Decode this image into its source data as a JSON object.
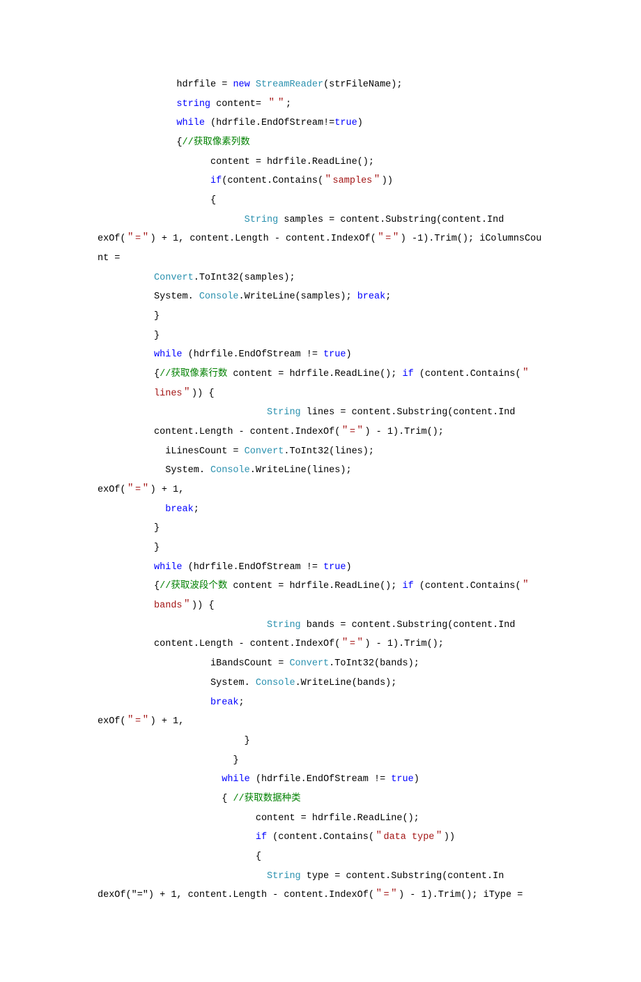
{
  "code": {
    "lines": [
      [
        {
          "indent": 14,
          "text": "hdrfile = ",
          "cls": "tok-plain"
        },
        {
          "text": "new ",
          "cls": "tok-kw"
        },
        {
          "text": "StreamReader",
          "cls": "tok-cls"
        },
        {
          "text": "(strFileName);",
          "cls": "tok-plain"
        }
      ],
      [
        {
          "indent": 14,
          "text": "string",
          "cls": "tok-kw"
        },
        {
          "text": " content= ",
          "cls": "tok-plain"
        },
        {
          "text": "＂＂",
          "cls": "tok-str"
        },
        {
          "text": ";",
          "cls": "tok-plain"
        }
      ],
      [
        {
          "indent": 14,
          "text": "while",
          "cls": "tok-kw"
        },
        {
          "text": " (hdrfile.EndOfStream!=",
          "cls": "tok-plain"
        },
        {
          "text": "true",
          "cls": "tok-kw"
        },
        {
          "text": ")",
          "cls": "tok-plain"
        }
      ],
      [
        {
          "indent": 14,
          "text": "{",
          "cls": "tok-plain"
        },
        {
          "text": "//获取像素列数",
          "cls": "tok-cmt"
        }
      ],
      [
        {
          "indent": 20,
          "text": "content = hdrfile.ReadLine();",
          "cls": "tok-plain"
        }
      ],
      [
        {
          "indent": 20,
          "text": "if",
          "cls": "tok-kw"
        },
        {
          "text": "(content.Contains(",
          "cls": "tok-plain"
        },
        {
          "text": "＂samples＂",
          "cls": "tok-str"
        },
        {
          "text": "))",
          "cls": "tok-plain"
        }
      ],
      [
        {
          "indent": 20,
          "text": "{",
          "cls": "tok-plain"
        }
      ],
      [
        {
          "indent": 26,
          "text": "String",
          "cls": "tok-cls"
        },
        {
          "text": " samples = content.Substring(content.Ind",
          "cls": "tok-plain"
        }
      ],
      [
        {
          "indent": 0,
          "text": "exOf(",
          "cls": "tok-plain"
        },
        {
          "text": "＂=＂",
          "cls": "tok-str"
        },
        {
          "text": ") + 1, content.Length - content.IndexOf(",
          "cls": "tok-plain"
        },
        {
          "text": "＂=＂",
          "cls": "tok-str"
        },
        {
          "text": ") -1).Trim(); iColumnsCount = ",
          "cls": "tok-plain"
        }
      ],
      [
        {
          "indent": 10,
          "text": "Convert",
          "cls": "tok-cls"
        },
        {
          "text": ".ToInt32(samples);",
          "cls": "tok-plain"
        }
      ],
      [
        {
          "indent": 10,
          "text": "System. ",
          "cls": "tok-plain"
        },
        {
          "text": "Console",
          "cls": "tok-cls"
        },
        {
          "text": ".WriteLine(samples); ",
          "cls": "tok-plain"
        },
        {
          "text": "break",
          "cls": "tok-kw"
        },
        {
          "text": ";",
          "cls": "tok-plain"
        }
      ],
      [
        {
          "indent": 10,
          "text": "}",
          "cls": "tok-plain"
        }
      ],
      [
        {
          "indent": 10,
          "text": "}",
          "cls": "tok-plain"
        }
      ],
      [
        {
          "indent": 10,
          "text": "while",
          "cls": "tok-kw"
        },
        {
          "text": " (hdrfile.EndOfStream != ",
          "cls": "tok-plain"
        },
        {
          "text": "true",
          "cls": "tok-kw"
        },
        {
          "text": ")",
          "cls": "tok-plain"
        }
      ],
      [
        {
          "indent": 10,
          "text": "{",
          "cls": "tok-plain"
        },
        {
          "text": "//获取像素行数",
          "cls": "tok-cmt"
        },
        {
          "text": " content = hdrfile.ReadLine(); ",
          "cls": "tok-plain"
        },
        {
          "text": "if",
          "cls": "tok-kw"
        },
        {
          "text": " (content.Contains(",
          "cls": "tok-plain"
        },
        {
          "text": "＂",
          "cls": "tok-str"
        }
      ],
      [
        {
          "indent": 10,
          "text": "lines＂",
          "cls": "tok-str"
        },
        {
          "text": ")) {",
          "cls": "tok-plain"
        }
      ],
      [
        {
          "indent": 30,
          "text": "String",
          "cls": "tok-cls"
        },
        {
          "text": " lines = content.Substring(content.Ind",
          "cls": "tok-plain"
        }
      ],
      [
        {
          "indent": 10,
          "text": "content.Length - content.IndexOf(",
          "cls": "tok-plain"
        },
        {
          "text": "＂=＂",
          "cls": "tok-str"
        },
        {
          "text": ") - 1).Trim();",
          "cls": "tok-plain"
        }
      ],
      [
        {
          "indent": 12,
          "text": "iLinesCount = ",
          "cls": "tok-plain"
        },
        {
          "text": "Convert",
          "cls": "tok-cls"
        },
        {
          "text": ".ToInt32(lines);",
          "cls": "tok-plain"
        }
      ],
      [
        {
          "indent": 12,
          "text": "System. ",
          "cls": "tok-plain"
        },
        {
          "text": "Console",
          "cls": "tok-cls"
        },
        {
          "text": ".WriteLine(lines);",
          "cls": "tok-plain"
        }
      ],
      [
        {
          "indent": 0,
          "text": "exOf(",
          "cls": "tok-plain"
        },
        {
          "text": "＂=＂",
          "cls": "tok-str"
        },
        {
          "text": ") + 1,",
          "cls": "tok-plain"
        }
      ],
      [
        {
          "indent": 12,
          "text": "break",
          "cls": "tok-kw"
        },
        {
          "text": ";",
          "cls": "tok-plain"
        }
      ],
      [
        {
          "indent": 10,
          "text": "}",
          "cls": "tok-plain"
        }
      ],
      [
        {
          "indent": 10,
          "text": "}",
          "cls": "tok-plain"
        }
      ],
      [
        {
          "indent": 10,
          "text": "while",
          "cls": "tok-kw"
        },
        {
          "text": " (hdrfile.EndOfStream != ",
          "cls": "tok-plain"
        },
        {
          "text": "true",
          "cls": "tok-kw"
        },
        {
          "text": ")",
          "cls": "tok-plain"
        }
      ],
      [
        {
          "indent": 10,
          "text": "{",
          "cls": "tok-plain"
        },
        {
          "text": "//获取波段个数",
          "cls": "tok-cmt"
        },
        {
          "text": " content = hdrfile.ReadLine(); ",
          "cls": "tok-plain"
        },
        {
          "text": "if",
          "cls": "tok-kw"
        },
        {
          "text": " (content.Contains(",
          "cls": "tok-plain"
        },
        {
          "text": "＂",
          "cls": "tok-str"
        }
      ],
      [
        {
          "indent": 10,
          "text": "bands＂",
          "cls": "tok-str"
        },
        {
          "text": ")) {",
          "cls": "tok-plain"
        }
      ],
      [
        {
          "indent": 30,
          "text": "String",
          "cls": "tok-cls"
        },
        {
          "text": " bands = content.Substring(content.Ind",
          "cls": "tok-plain"
        }
      ],
      [
        {
          "indent": 10,
          "text": "content.Length - content.IndexOf(",
          "cls": "tok-plain"
        },
        {
          "text": "＂=＂",
          "cls": "tok-str"
        },
        {
          "text": ") - 1).Trim();",
          "cls": "tok-plain"
        }
      ],
      [
        {
          "indent": 20,
          "text": "iBandsCount = ",
          "cls": "tok-plain"
        },
        {
          "text": "Convert",
          "cls": "tok-cls"
        },
        {
          "text": ".ToInt32(bands);",
          "cls": "tok-plain"
        }
      ],
      [
        {
          "indent": 20,
          "text": "System. ",
          "cls": "tok-plain"
        },
        {
          "text": "Console",
          "cls": "tok-cls"
        },
        {
          "text": ".WriteLine(bands);",
          "cls": "tok-plain"
        }
      ],
      [
        {
          "indent": 20,
          "text": "break",
          "cls": "tok-kw"
        },
        {
          "text": ";",
          "cls": "tok-plain"
        }
      ],
      [
        {
          "indent": 0,
          "text": "exOf(",
          "cls": "tok-plain"
        },
        {
          "text": "＂=＂",
          "cls": "tok-str"
        },
        {
          "text": ") + 1,",
          "cls": "tok-plain"
        }
      ],
      [
        {
          "indent": 26,
          "text": "}",
          "cls": "tok-plain"
        }
      ],
      [
        {
          "indent": 24,
          "text": "}",
          "cls": "tok-plain"
        }
      ],
      [
        {
          "indent": 22,
          "text": "while",
          "cls": "tok-kw"
        },
        {
          "text": " (hdrfile.EndOfStream != ",
          "cls": "tok-plain"
        },
        {
          "text": "true",
          "cls": "tok-kw"
        },
        {
          "text": ")",
          "cls": "tok-plain"
        }
      ],
      [
        {
          "indent": 22,
          "text": "{ ",
          "cls": "tok-plain"
        },
        {
          "text": "//获取数据种类",
          "cls": "tok-cmt"
        }
      ],
      [
        {
          "indent": 28,
          "text": "content = hdrfile.ReadLine();",
          "cls": "tok-plain"
        }
      ],
      [
        {
          "indent": 28,
          "text": "if",
          "cls": "tok-kw"
        },
        {
          "text": " (content.Contains(",
          "cls": "tok-plain"
        },
        {
          "text": "＂data type＂",
          "cls": "tok-str"
        },
        {
          "text": "))",
          "cls": "tok-plain"
        }
      ],
      [
        {
          "indent": 28,
          "text": "{",
          "cls": "tok-plain"
        }
      ],
      [
        {
          "indent": 30,
          "text": "String",
          "cls": "tok-cls"
        },
        {
          "text": " type = content.Substring(content.In",
          "cls": "tok-plain"
        }
      ],
      [
        {
          "indent": 0,
          "text": "dexOf(\"=\") + 1, content.Length - content.IndexOf(",
          "cls": "tok-plain"
        },
        {
          "text": "＂=＂",
          "cls": "tok-str"
        },
        {
          "text": ") - 1).Trim(); iType = ",
          "cls": "tok-plain"
        }
      ]
    ]
  }
}
